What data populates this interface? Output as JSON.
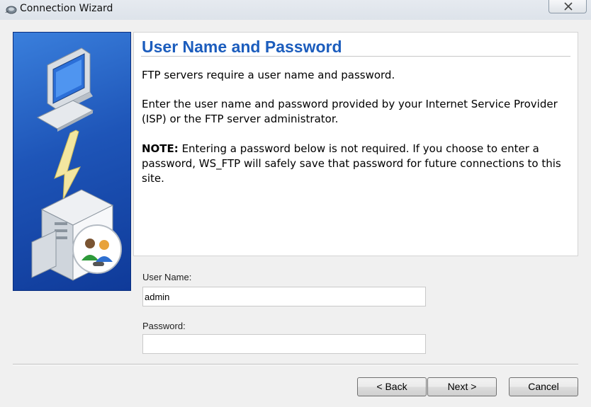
{
  "window": {
    "title": "Connection Wizard",
    "close_glyph": "✕"
  },
  "icons": {
    "app": "ftp-app-icon",
    "close": "close-icon",
    "client_computer": "client-computer-icon",
    "connection": "lightning-bolt-icon",
    "server": "server-tower-icon",
    "users": "users-key-icon"
  },
  "content": {
    "heading": "User Name and Password",
    "paragraph1": "FTP servers require a user name and password.",
    "paragraph2": "Enter the user name and password provided by your Internet Service Provider (ISP) or the FTP server administrator.",
    "note_label": "NOTE:",
    "note_text": " Entering a password below is not required. If you choose to enter a password, WS_FTP will safely save that password for future connections to this site."
  },
  "form": {
    "username_label": "User Name:",
    "username_value": "admin",
    "password_label": "Password:",
    "password_value": ""
  },
  "buttons": {
    "back": "< Back",
    "next": "Next >",
    "cancel": "Cancel"
  },
  "colors": {
    "heading": "#1c5dbd",
    "panel_blue": "#1e55b8"
  }
}
